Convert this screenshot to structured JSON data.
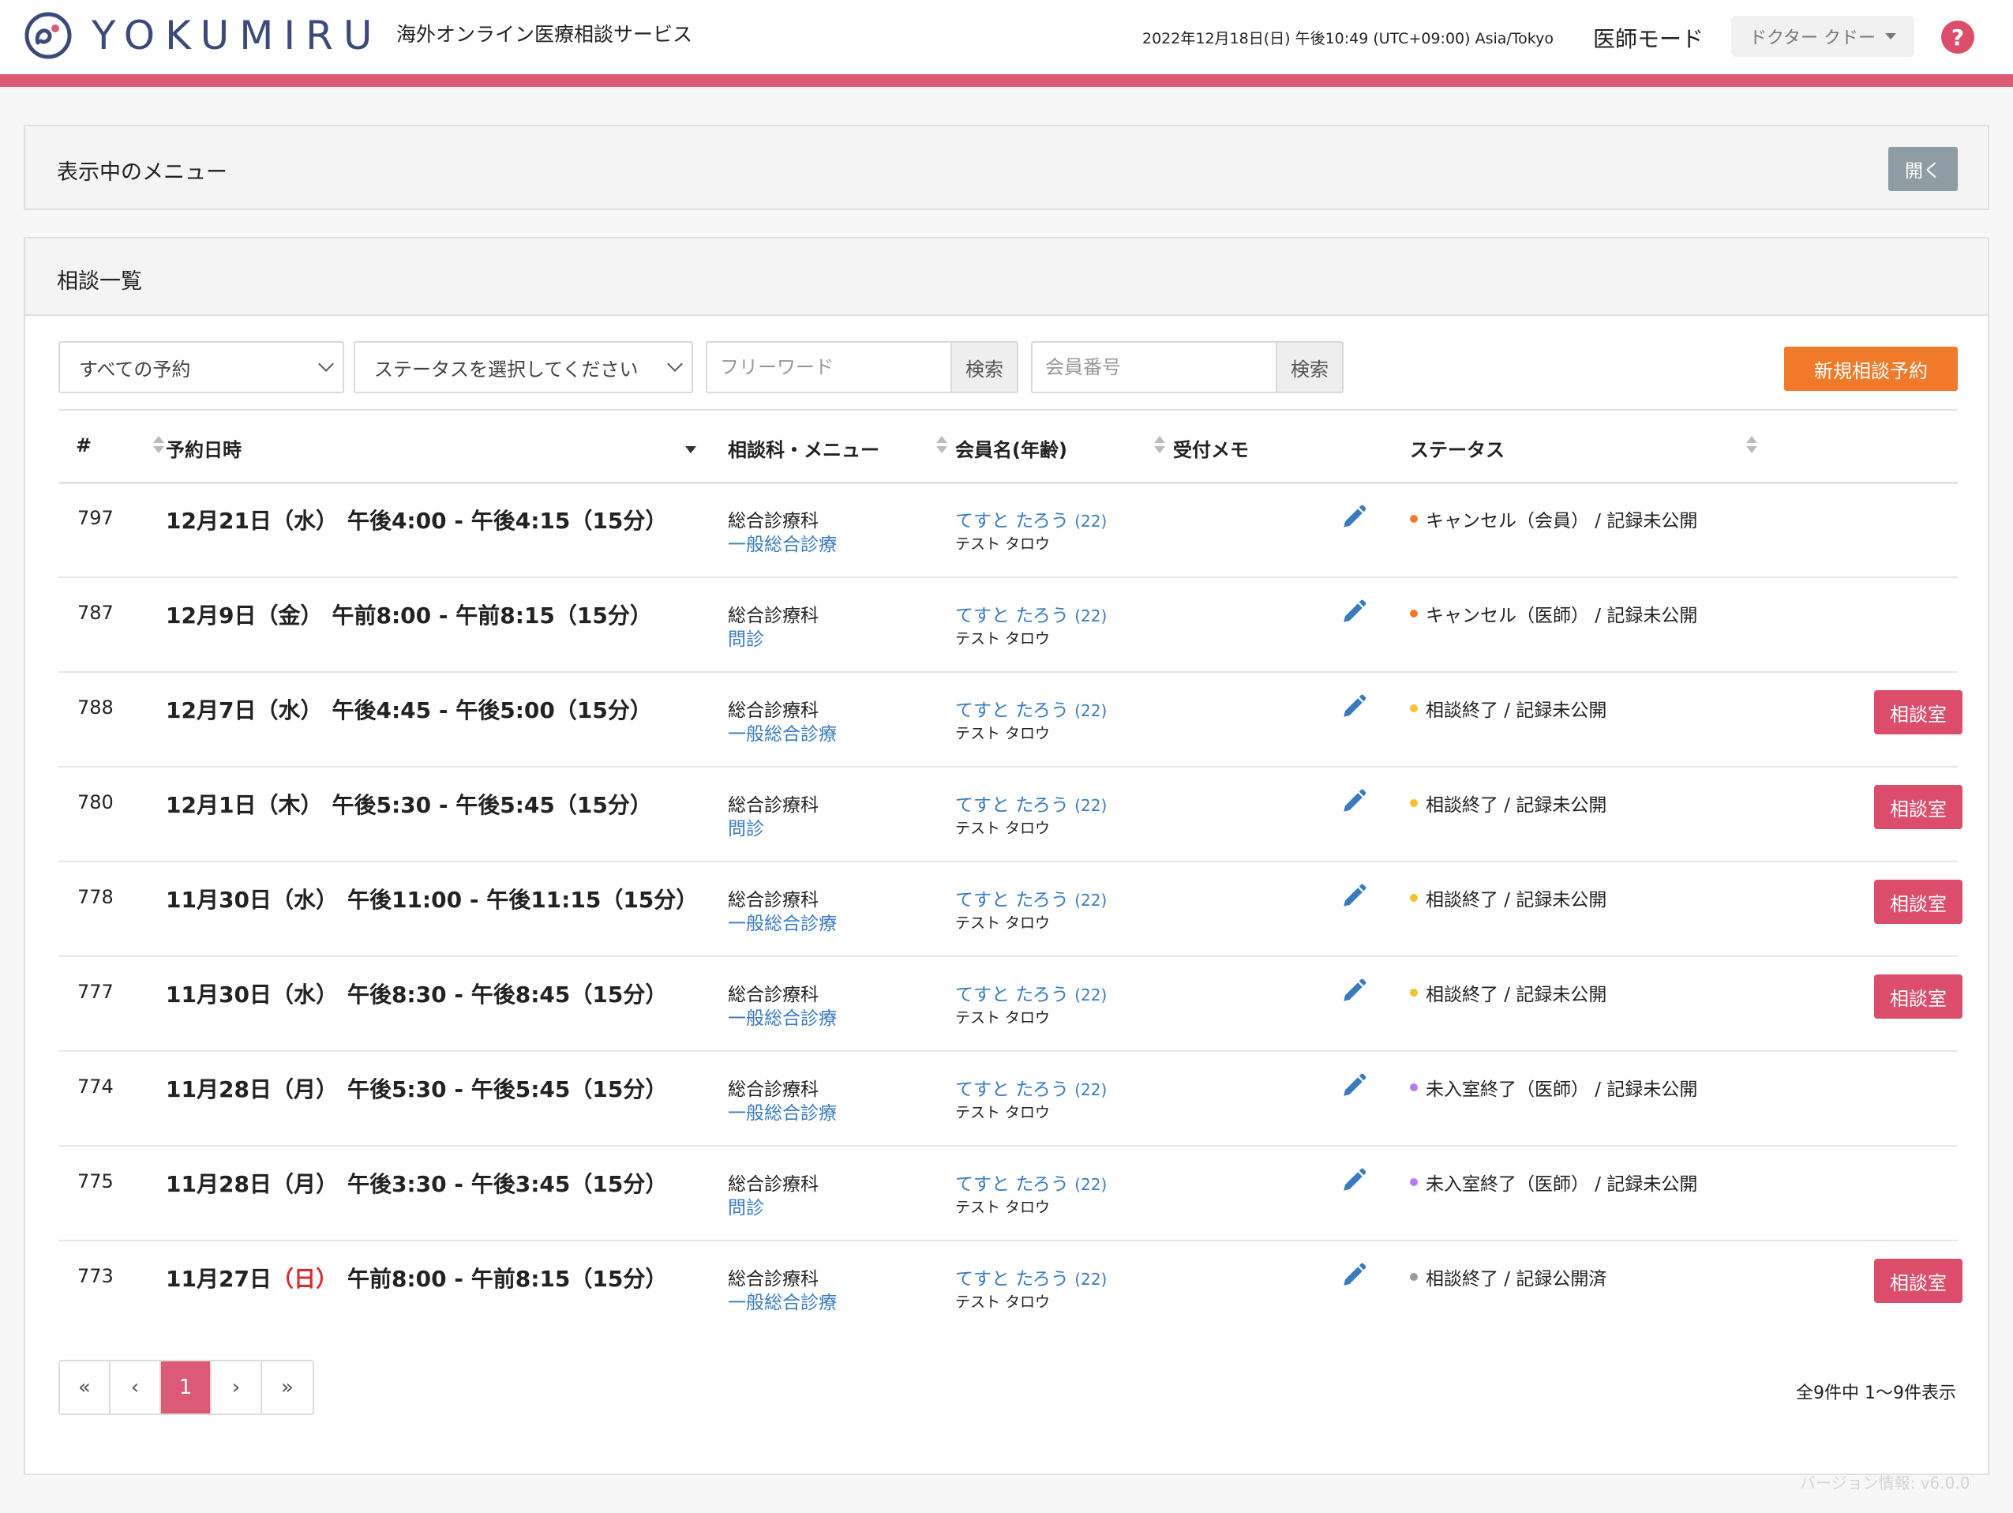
{
  "header": {
    "logo_text": "YOKUMIRU",
    "service_name": "海外オンライン医療相談サービス",
    "datetime": "2022年12月18日(日) 午後10:49 (UTC+09:00) Asia/Tokyo",
    "mode": "医師モード",
    "user_name": "ドクター クドー",
    "help_label": "?"
  },
  "menu_card": {
    "title": "表示中のメニュー",
    "open_label": "開く"
  },
  "list": {
    "title": "相談一覧",
    "filter_reservation": "すべての予約",
    "filter_status": "ステータスを選択してください",
    "freeword_placeholder": "フリーワード",
    "member_placeholder": "会員番号",
    "search_label": "検索",
    "new_label": "新規相談予約",
    "columns": {
      "id": "#",
      "datetime": "予約日時",
      "dept": "相談科・メニュー",
      "member": "会員名(年齢)",
      "memo": "受付メモ",
      "status": "ステータス"
    },
    "room_label": "相談室",
    "rows": [
      {
        "id": "797",
        "md": "12月21日",
        "wd": "（水）",
        "time": "午後4:00 - 午後4:15（15分）",
        "sunday": false,
        "dept": "総合診療科",
        "menu": "一般総合診療",
        "name": "てすと たろう",
        "age": "(22)",
        "kana": "テスト タロウ",
        "status": "キャンセル（会員） / 記録未公開",
        "status_color": "#f07a2a",
        "room": false
      },
      {
        "id": "787",
        "md": "12月9日",
        "wd": "（金）",
        "time": "午前8:00 - 午前8:15（15分）",
        "sunday": false,
        "dept": "総合診療科",
        "menu": "問診",
        "name": "てすと たろう",
        "age": "(22)",
        "kana": "テスト タロウ",
        "status": "キャンセル（医師） / 記録未公開",
        "status_color": "#f07a2a",
        "room": false
      },
      {
        "id": "788",
        "md": "12月7日",
        "wd": "（水）",
        "time": "午後4:45 - 午後5:00（15分）",
        "sunday": false,
        "dept": "総合診療科",
        "menu": "一般総合診療",
        "name": "てすと たろう",
        "age": "(22)",
        "kana": "テスト タロウ",
        "status": "相談終了 / 記録未公開",
        "status_color": "#f2c230",
        "room": true
      },
      {
        "id": "780",
        "md": "12月1日",
        "wd": "（木）",
        "time": "午後5:30 - 午後5:45（15分）",
        "sunday": false,
        "dept": "総合診療科",
        "menu": "問診",
        "name": "てすと たろう",
        "age": "(22)",
        "kana": "テスト タロウ",
        "status": "相談終了 / 記録未公開",
        "status_color": "#f2c230",
        "room": true
      },
      {
        "id": "778",
        "md": "11月30日",
        "wd": "（水）",
        "time": "午後11:00 - 午後11:15（15分）",
        "sunday": false,
        "dept": "総合診療科",
        "menu": "一般総合診療",
        "name": "てすと たろう",
        "age": "(22)",
        "kana": "テスト タロウ",
        "status": "相談終了 / 記録未公開",
        "status_color": "#f2c230",
        "room": true
      },
      {
        "id": "777",
        "md": "11月30日",
        "wd": "（水）",
        "time": "午後8:30 - 午後8:45（15分）",
        "sunday": false,
        "dept": "総合診療科",
        "menu": "一般総合診療",
        "name": "てすと たろう",
        "age": "(22)",
        "kana": "テスト タロウ",
        "status": "相談終了 / 記録未公開",
        "status_color": "#f2c230",
        "room": true
      },
      {
        "id": "774",
        "md": "11月28日",
        "wd": "（月）",
        "time": "午後5:30 - 午後5:45（15分）",
        "sunday": false,
        "dept": "総合診療科",
        "menu": "一般総合診療",
        "name": "てすと たろう",
        "age": "(22)",
        "kana": "テスト タロウ",
        "status": "未入室終了（医師） / 記録未公開",
        "status_color": "#b57ae8",
        "room": false
      },
      {
        "id": "775",
        "md": "11月28日",
        "wd": "（月）",
        "time": "午後3:30 - 午後3:45（15分）",
        "sunday": false,
        "dept": "総合診療科",
        "menu": "問診",
        "name": "てすと たろう",
        "age": "(22)",
        "kana": "テスト タロウ",
        "status": "未入室終了（医師） / 記録未公開",
        "status_color": "#b57ae8",
        "room": false
      },
      {
        "id": "773",
        "md": "11月27日",
        "wd": "（日）",
        "time": "午前8:00 - 午前8:15（15分）",
        "sunday": true,
        "dept": "総合診療科",
        "menu": "一般総合診療",
        "name": "てすと たろう",
        "age": "(22)",
        "kana": "テスト タロウ",
        "status": "相談終了 / 記録公開済",
        "status_color": "#999999",
        "room": true
      }
    ]
  },
  "pagination": {
    "first": "«",
    "prev": "‹",
    "current": "1",
    "next": "›",
    "last": "»",
    "summary": "全9件中 1〜9件表示"
  },
  "footer": {
    "version": "バージョン情報: v6.0.0"
  },
  "colors": {
    "brand": "#dc5a75",
    "accent_orange": "#f07a2a",
    "link": "#3a7bbd",
    "room_button": "#dc4d6b"
  }
}
